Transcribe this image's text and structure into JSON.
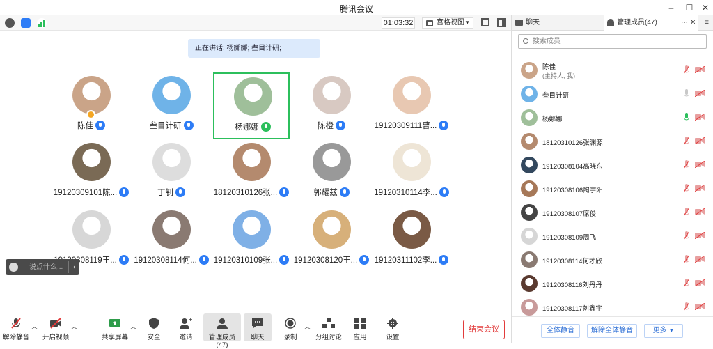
{
  "window": {
    "title": "腾讯会议"
  },
  "topbar": {
    "timer": "01:03:32",
    "view_label": "宫格视图"
  },
  "speaking": {
    "text": "正在讲话: 杨娜娜; 叁目计研;"
  },
  "participants": [
    {
      "name": "陈佳",
      "color": "#caa488"
    },
    {
      "name": "叁目计研",
      "color": "#6fb3e8"
    },
    {
      "name": "杨娜娜",
      "color": "#9fbf9a"
    },
    {
      "name": "陈橙",
      "color": "#d8c9c2"
    },
    {
      "name": "19120309111曹...",
      "color": "#e8c8b2"
    },
    {
      "name": "19120309101陈...",
      "color": "#7a6a55"
    },
    {
      "name": "丁钊",
      "color": "#ddd"
    },
    {
      "name": "18120310126张...",
      "color": "#b48a6e"
    },
    {
      "name": "郭耀兹",
      "color": "#999"
    },
    {
      "name": "19120310114李...",
      "color": "#eee5d6"
    },
    {
      "name": "19120308119王...",
      "color": "#d7d7d7"
    },
    {
      "name": "19120308114何...",
      "color": "#8a7a72"
    },
    {
      "name": "19120310109张...",
      "color": "#7fb0e6"
    },
    {
      "name": "19120308120王...",
      "color": "#d7b07a"
    },
    {
      "name": "19120311102李...",
      "color": "#7a5a45"
    }
  ],
  "chat_input": {
    "placeholder": "说点什么..."
  },
  "toolbar": {
    "unmute": "解除静音",
    "start_video": "开启视频",
    "share_screen": "共享屏幕",
    "security": "安全",
    "invite": "邀请",
    "manage_members": "管理成员(47)",
    "chat": "聊天",
    "record": "录制",
    "breakout": "分组讨论",
    "apps": "应用",
    "settings": "设置",
    "end_meeting": "结束会议"
  },
  "panel": {
    "tab_chat": "聊天",
    "tab_members": "管理成员(47)",
    "search_placeholder": "搜索成员",
    "members": [
      {
        "name": "陈佳",
        "sub": "(主持人, 我)",
        "color": "#caa488",
        "mic": "muted"
      },
      {
        "name": "叁目计研",
        "color": "#6fb3e8",
        "mic": "off"
      },
      {
        "name": "杨娜娜",
        "color": "#9fbf9a",
        "mic": "on"
      },
      {
        "name": "18120310126张渊源",
        "color": "#b48a6e",
        "mic": "muted"
      },
      {
        "name": "19120308104高晓东",
        "color": "#33485e",
        "mic": "muted"
      },
      {
        "name": "19120308106陶宇阳",
        "color": "#a67858",
        "mic": "muted"
      },
      {
        "name": "19120308107席俊",
        "color": "#444",
        "mic": "muted"
      },
      {
        "name": "19120308109周飞",
        "color": "#d6d6d6",
        "mic": "muted"
      },
      {
        "name": "19120308114何才欣",
        "color": "#8a7a72",
        "mic": "muted"
      },
      {
        "name": "19120308116刘丹丹",
        "color": "#5a3a30",
        "mic": "muted"
      },
      {
        "name": "19120308117刘鑫宇",
        "color": "#c89a9a",
        "mic": "muted"
      }
    ],
    "mute_all": "全体静音",
    "unmute_all": "解除全体静音",
    "more": "更多"
  }
}
